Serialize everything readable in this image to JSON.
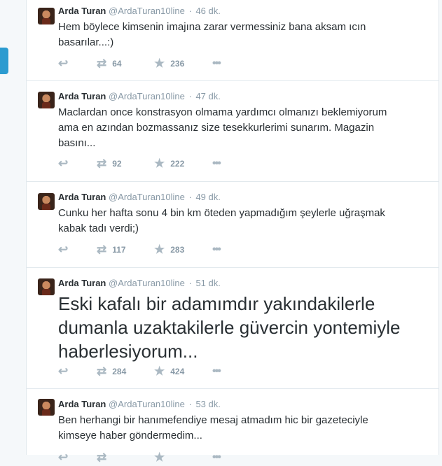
{
  "tweets": [
    {
      "name": "Arda Turan",
      "handle": "@ArdaTuran10line",
      "time": "46 dk.",
      "text": "Hem böylece kimsenin imajına zarar vermessiniz bana aksam ıcın\nbasarılar...:)",
      "retweets": "64",
      "favorites": "236"
    },
    {
      "name": "Arda Turan",
      "handle": "@ArdaTuran10line",
      "time": "47 dk.",
      "text": "Maclardan once konstrasyon olmama yardımcı olmanızı beklemiyorum\nama en azından bozmassanız size  tesekkurlerimi sunarım. Magazin\nbasını...",
      "retweets": "92",
      "favorites": "222"
    },
    {
      "name": "Arda Turan",
      "handle": "@ArdaTuran10line",
      "time": "49 dk.",
      "text": "Cunku her hafta sonu 4 bin km öteden yapmadığım şeylerle uğraşmak\nkabak tadı verdi;)",
      "retweets": "117",
      "favorites": "283"
    },
    {
      "name": "Arda Turan",
      "handle": "@ArdaTuran10line",
      "time": "51 dk.",
      "text": "Eski kafalı bir adamımdır yakındakilerle\ndumanla uzaktakilerle güvercin yontemiyle\nhaberlesiyorum...",
      "retweets": "284",
      "favorites": "424"
    },
    {
      "name": "Arda Turan",
      "handle": "@ArdaTuran10line",
      "time": "53 dk.",
      "text": "Ben herhangi bir hanımefendiye mesaj atmadım hic bir gazeteciyle\nkimseye haber göndermedim...",
      "retweets": "",
      "favorites": ""
    }
  ],
  "header_separator": "·",
  "icons": {
    "reply": "reply-icon",
    "retweet": "retweet-icon",
    "favorite": "star-icon",
    "more": "more-icon"
  }
}
